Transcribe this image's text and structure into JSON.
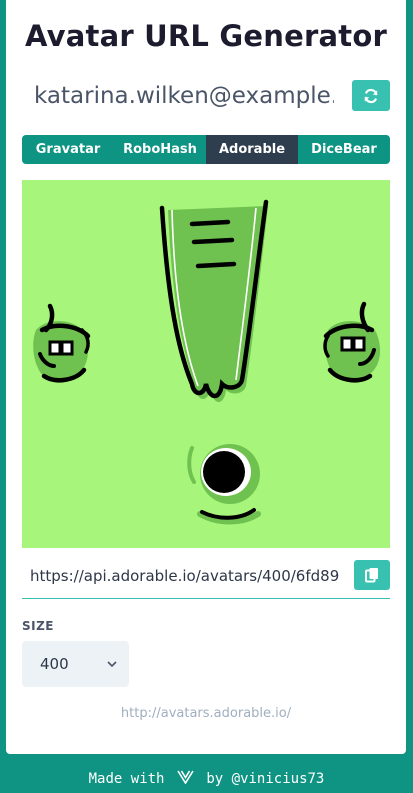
{
  "title": "Avatar URL Generator",
  "email": {
    "value": "katarina.wilken@example.c"
  },
  "refresh": {
    "icon": "refresh-icon"
  },
  "tabs": [
    {
      "label": "Gravatar",
      "active": false
    },
    {
      "label": "RoboHash",
      "active": false
    },
    {
      "label": "Adorable",
      "active": true
    },
    {
      "label": "DiceBear",
      "active": false
    }
  ],
  "avatar": {
    "background": "#a8f57c",
    "shadow": "#6fc24f"
  },
  "url": {
    "value": "https://api.adorable.io/avatars/400/6fd89"
  },
  "copy": {
    "icon": "copy-icon"
  },
  "size": {
    "label": "SIZE",
    "selected": "400"
  },
  "service_link": "http://avatars.adorable.io/",
  "footer": {
    "made_with": "Made with",
    "by": "by @vinicius73",
    "icon": "vue-logo-icon"
  },
  "colors": {
    "accent": "#38c1b0",
    "brand": "#0f9483",
    "tab_active": "#2f3e4e"
  }
}
